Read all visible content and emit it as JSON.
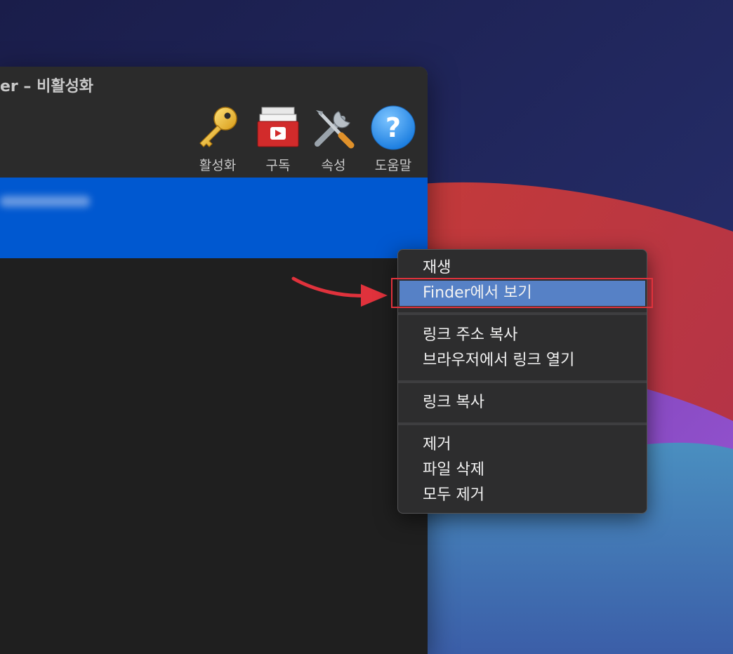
{
  "window": {
    "title": "er – 비활성화"
  },
  "toolbar": {
    "buttons": [
      {
        "label": "활성화",
        "icon": "key-icon"
      },
      {
        "label": "구독",
        "icon": "subscribe-icon"
      },
      {
        "label": "속성",
        "icon": "tools-icon"
      },
      {
        "label": "도움말",
        "icon": "help-icon"
      }
    ]
  },
  "context_menu": {
    "items": [
      {
        "label": "재생"
      },
      {
        "label": "Finder에서 보기",
        "highlighted": true
      },
      {
        "label": "링크 주소 복사"
      },
      {
        "label": "브라우저에서 링크 열기"
      },
      {
        "label": "링크 복사"
      },
      {
        "label": "제거"
      },
      {
        "label": "파일 삭제"
      },
      {
        "label": "모두 제거"
      }
    ]
  },
  "colors": {
    "selection_blue": "#0058d0",
    "menu_highlight": "#5681c6",
    "annotation_red": "#e0323c"
  }
}
